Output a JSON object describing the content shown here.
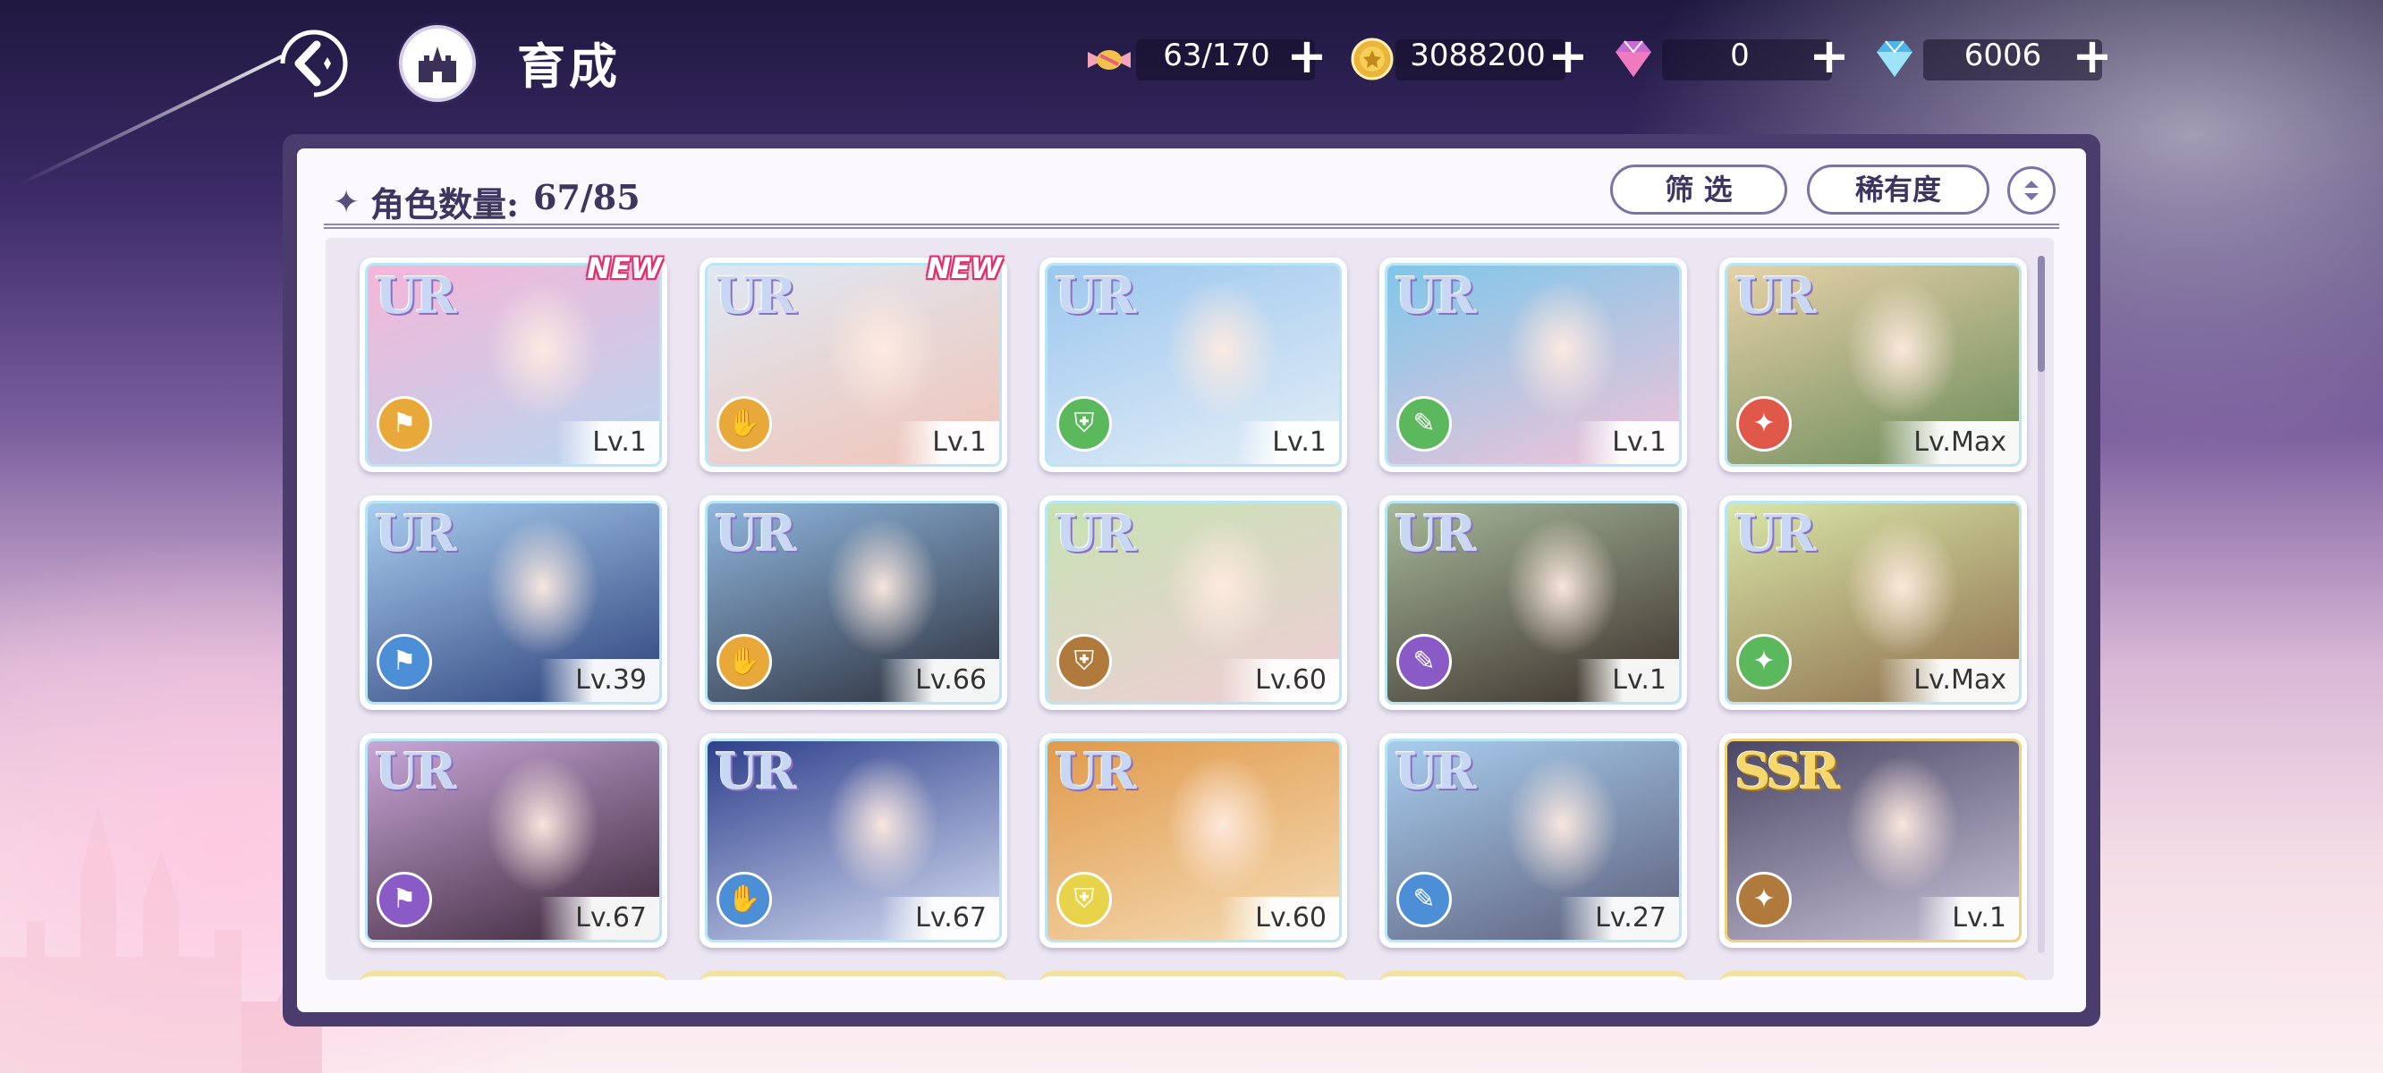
{
  "header": {
    "title": "育成"
  },
  "resources": [
    {
      "icon": "candy-icon",
      "value": "63/170"
    },
    {
      "icon": "gold-coin-icon",
      "value": "3088200"
    },
    {
      "icon": "pink-diamond-icon",
      "value": "0"
    },
    {
      "icon": "blue-diamond-icon",
      "value": "6006"
    }
  ],
  "panel": {
    "count_label": "角色数量:",
    "count_value": "67/85",
    "filter_label": "筛 选",
    "rarity_label": "稀有度"
  },
  "cards": [
    {
      "rarity": "UR",
      "level": "Lv.1",
      "new": "NEW",
      "role_color": "#e8a93a",
      "bg": [
        "#f4b6d8",
        "#b9d6ef"
      ]
    },
    {
      "rarity": "UR",
      "level": "Lv.1",
      "new": "NEW",
      "role_color": "#e8a93a",
      "bg": [
        "#dfe8f3",
        "#f0c4b8"
      ]
    },
    {
      "rarity": "UR",
      "level": "Lv.1",
      "new": "",
      "role_color": "#5cb85c",
      "bg": [
        "#9cc7ef",
        "#e5eef6"
      ]
    },
    {
      "rarity": "UR",
      "level": "Lv.1",
      "new": "",
      "role_color": "#5cb85c",
      "bg": [
        "#7fc6ea",
        "#f2c4d8"
      ]
    },
    {
      "rarity": "UR",
      "level": "Lv.Max",
      "new": "",
      "role_color": "#e0584a",
      "bg": [
        "#e6d2a8",
        "#6b8a5a"
      ]
    },
    {
      "rarity": "UR",
      "level": "Lv.39",
      "new": "",
      "role_color": "#4d8fd6",
      "bg": [
        "#a9cdef",
        "#2b3f7a"
      ]
    },
    {
      "rarity": "UR",
      "level": "Lv.66",
      "new": "",
      "role_color": "#e8a93a",
      "bg": [
        "#8fb6de",
        "#2c2f3a"
      ]
    },
    {
      "rarity": "UR",
      "level": "Lv.60",
      "new": "",
      "role_color": "#b07a3c",
      "bg": [
        "#c7e2b4",
        "#f0cdd6"
      ]
    },
    {
      "rarity": "UR",
      "level": "Lv.1",
      "new": "",
      "role_color": "#8a5bc7",
      "bg": [
        "#a6b89a",
        "#3b2f2b"
      ]
    },
    {
      "rarity": "UR",
      "level": "Lv.Max",
      "new": "",
      "role_color": "#5cb85c",
      "bg": [
        "#d8e6a8",
        "#8d6d4c"
      ]
    },
    {
      "rarity": "UR",
      "level": "Lv.67",
      "new": "",
      "role_color": "#8a5bc7",
      "bg": [
        "#c8a7d8",
        "#3a2436"
      ]
    },
    {
      "rarity": "UR",
      "level": "Lv.67",
      "new": "",
      "role_color": "#4d8fd6",
      "bg": [
        "#2e3f8c",
        "#d6def2"
      ]
    },
    {
      "rarity": "UR",
      "level": "Lv.60",
      "new": "",
      "role_color": "#e8d44a",
      "bg": [
        "#e09a4c",
        "#f5dcb6"
      ]
    },
    {
      "rarity": "UR",
      "level": "Lv.27",
      "new": "",
      "role_color": "#4d8fd6",
      "bg": [
        "#a9cdef",
        "#5c5f7a"
      ]
    },
    {
      "rarity": "SSR",
      "level": "Lv.1",
      "new": "",
      "role_color": "#b07a3c",
      "bg": [
        "#4a4664",
        "#c9c3d8"
      ]
    }
  ]
}
